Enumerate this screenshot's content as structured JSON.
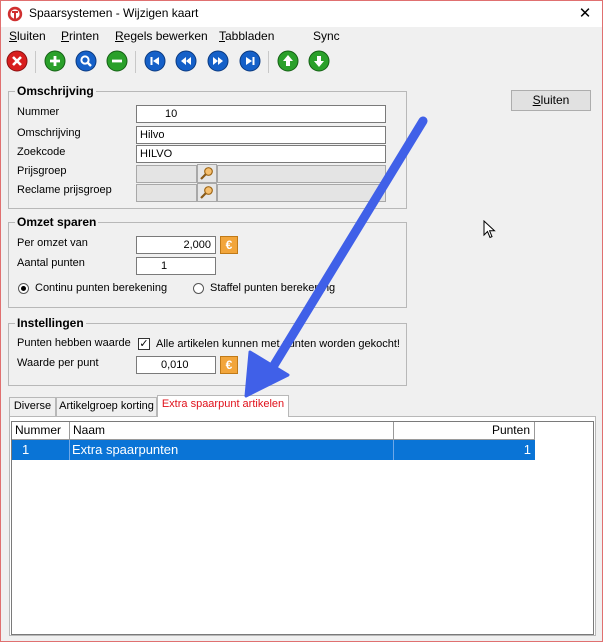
{
  "window": {
    "title": "Spaarsystemen - Wijzigen kaart",
    "close_glyph": "✕"
  },
  "menu": [
    {
      "label": "Sluiten",
      "underline": "S"
    },
    {
      "label": "Printen",
      "underline": "P"
    },
    {
      "label": "Regels bewerken",
      "underline": "R"
    },
    {
      "label": "Tabbladen",
      "underline": "T"
    },
    {
      "label": "Sync",
      "underline": ""
    }
  ],
  "toolbar": {
    "icons": [
      "close-record-icon",
      "add-icon",
      "search-icon",
      "remove-icon",
      "first-record-icon",
      "previous-record-icon",
      "next-record-icon",
      "last-record-icon",
      "move-up-icon",
      "move-down-icon"
    ],
    "colors": {
      "red": "#d81e1e",
      "green": "#2aa02a",
      "blue": "#1560c8"
    }
  },
  "omschrijving": {
    "title": "Omschrijving",
    "nummer_label": "Nummer",
    "nummer_value": "10",
    "omschrijving_label": "Omschrijving",
    "omschrijving_value": "Hilvo",
    "zoekcode_label": "Zoekcode",
    "zoekcode_value": "HILVO",
    "prijsgroep_label": "Prijsgroep",
    "prijsgroep_value": "",
    "reclame_label": "Reclame prijsgroep",
    "reclame_value": ""
  },
  "omzet": {
    "title": "Omzet sparen",
    "per_omzet_label": "Per omzet van",
    "per_omzet_value": "2,000",
    "aantal_label": "Aantal punten",
    "aantal_value": "1",
    "continu_label": "Continu punten berekening",
    "continu_selected": true,
    "staffel_label": "Staffel punten berekening",
    "staffel_selected": false
  },
  "instellingen": {
    "title": "Instellingen",
    "punten_label": "Punten hebben waarde",
    "alle_label": "Alle artikelen kunnen met punten worden gekocht!",
    "alle_checked": true,
    "waarde_label": "Waarde per punt",
    "waarde_value": "0,010"
  },
  "sluiten_button": "Sluiten",
  "tabs": [
    {
      "label": "Diverse",
      "active": false
    },
    {
      "label": "Artikelgroep korting",
      "active": false
    },
    {
      "label": "Extra spaarpunt artikelen",
      "active": true
    }
  ],
  "grid": {
    "columns": [
      "Nummer",
      "Naam",
      "Punten"
    ],
    "rows": [
      {
        "nummer": "1",
        "naam": "Extra spaarpunten",
        "punten": "1"
      }
    ],
    "selection_color": "#0a74d6"
  },
  "annotation": {
    "arrow_color": "#4060e8"
  }
}
